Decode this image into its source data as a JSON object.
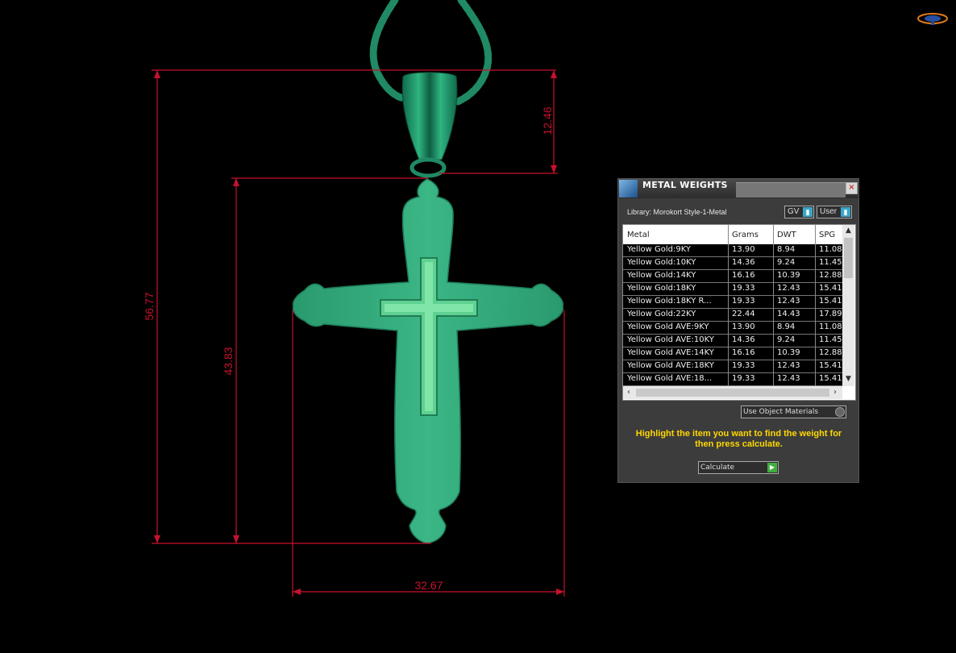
{
  "dimensions": {
    "overall_height": "56.77",
    "cross_height": "43.83",
    "bail_height": "12.46",
    "width": "32.67"
  },
  "colors": {
    "background": "#000000",
    "dimension_lines": "#c8102e",
    "model_green": "#2fa476",
    "hint_text": "#ffd700"
  },
  "panel": {
    "title": "METAL WEIGHTS",
    "close_icon": "close-icon",
    "library_label": "Library: Morokort Style-1-Metal",
    "combo_gv": "GV",
    "combo_user": "User",
    "table": {
      "headers": [
        "Metal",
        "Grams",
        "DWT",
        "SPG"
      ],
      "rows": [
        {
          "metal": "Yellow Gold:9KY",
          "grams": "13.90",
          "dwt": "8.94",
          "spg": "11.08"
        },
        {
          "metal": "Yellow Gold:10KY",
          "grams": "14.36",
          "dwt": "9.24",
          "spg": "11.45"
        },
        {
          "metal": "Yellow Gold:14KY",
          "grams": "16.16",
          "dwt": "10.39",
          "spg": "12.88"
        },
        {
          "metal": "Yellow Gold:18KY",
          "grams": "19.33",
          "dwt": "12.43",
          "spg": "15.41"
        },
        {
          "metal": "Yellow Gold:18KY R...",
          "grams": "19.33",
          "dwt": "12.43",
          "spg": "15.41"
        },
        {
          "metal": "Yellow Gold:22KY",
          "grams": "22.44",
          "dwt": "14.43",
          "spg": "17.89"
        },
        {
          "metal": "Yellow Gold AVE:9KY",
          "grams": "13.90",
          "dwt": "8.94",
          "spg": "11.08"
        },
        {
          "metal": "Yellow Gold AVE:10KY",
          "grams": "14.36",
          "dwt": "9.24",
          "spg": "11.45"
        },
        {
          "metal": "Yellow Gold AVE:14KY",
          "grams": "16.16",
          "dwt": "10.39",
          "spg": "12.88"
        },
        {
          "metal": "Yellow Gold AVE:18KY",
          "grams": "19.33",
          "dwt": "12.43",
          "spg": "15.41"
        },
        {
          "metal": "Yellow Gold AVE:18...",
          "grams": "19.33",
          "dwt": "12.43",
          "spg": "15.41"
        }
      ]
    },
    "use_object_materials": "Use Object Materials",
    "hint": "Highlight the item you want to find the weight for then press calculate.",
    "calculate_label": "Calculate"
  }
}
